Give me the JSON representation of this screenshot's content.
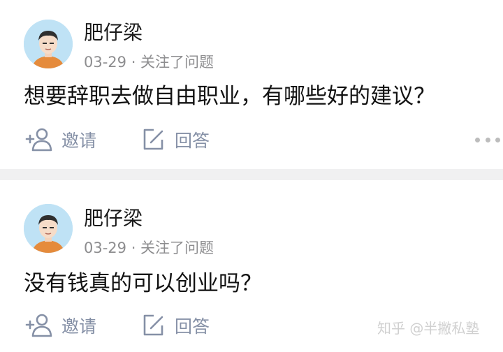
{
  "posts": [
    {
      "author": "肥仔梁",
      "meta": "03-29 · 关注了问题",
      "question": "想要辞职去做自由职业，有哪些好的建议？",
      "actions": {
        "invite": "邀请",
        "answer": "回答"
      }
    },
    {
      "author": "肥仔梁",
      "meta": "03-29 · 关注了问题",
      "question": "没有钱真的可以创业吗？",
      "actions": {
        "invite": "邀请",
        "answer": "回答"
      }
    }
  ],
  "watermark": "知乎 @半撇私塾",
  "icons": {
    "invite": "add-user-icon",
    "answer": "edit-answer-icon",
    "more": "more-horizontal-icon"
  },
  "colors": {
    "action": "#8590a6",
    "meta": "#8d8d8f",
    "divider": "#f0f0f1",
    "avatar_bg": "#bfe2f5"
  }
}
